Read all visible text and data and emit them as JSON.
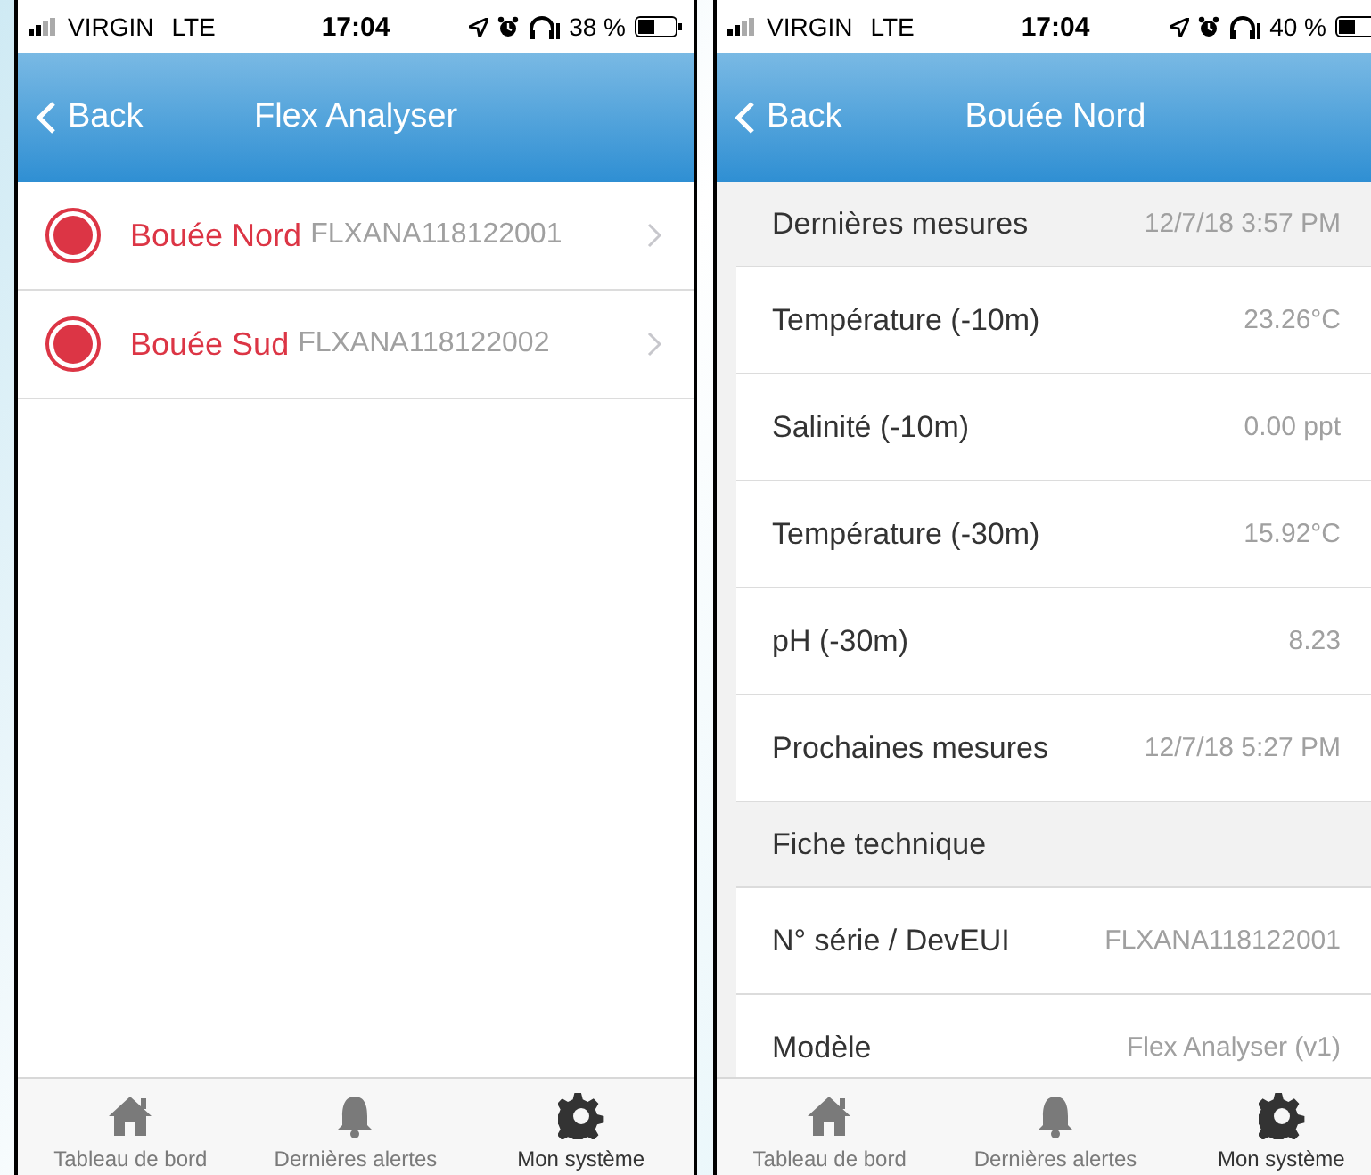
{
  "screens": [
    {
      "kind": "device_list",
      "status_bar": {
        "carrier": "VIRGIN",
        "network": "LTE",
        "time": "17:04",
        "battery_text": "38 %"
      },
      "nav": {
        "back": "Back",
        "title": "Flex Analyser"
      },
      "items": [
        {
          "name": "Bouée Nord",
          "serial": "FLXANA118122001",
          "color": "#dc3545"
        },
        {
          "name": "Bouée Sud",
          "serial": "FLXANA118122002",
          "color": "#dc3545"
        }
      ],
      "tab_bar": [
        {
          "label": "Tableau de bord",
          "selected": false
        },
        {
          "label": "Dernières alertes",
          "selected": false
        },
        {
          "label": "Mon système",
          "selected": true
        }
      ]
    },
    {
      "kind": "device_detail",
      "status_bar": {
        "carrier": "VIRGIN",
        "network": "LTE",
        "time": "17:04",
        "battery_text": "40 %"
      },
      "nav": {
        "back": "Back",
        "title": "Bouée Nord"
      },
      "rows": [
        {
          "kind": "header",
          "label": "Dernières mesures",
          "value": "12/7/18 3:57 PM"
        },
        {
          "kind": "row",
          "label": "Température (-10m)",
          "value": "23.26°C"
        },
        {
          "kind": "row",
          "label": "Salinité (-10m)",
          "value": "0.00 ppt"
        },
        {
          "kind": "row",
          "label": "Température (-30m)",
          "value": "15.92°C"
        },
        {
          "kind": "row",
          "label": "pH (-30m)",
          "value": "8.23"
        },
        {
          "kind": "row",
          "label": "Prochaines mesures",
          "value": "12/7/18 5:27 PM"
        },
        {
          "kind": "header",
          "label": "Fiche technique"
        },
        {
          "kind": "row",
          "label": "N° série / DevEUI",
          "value": "FLXANA118122001"
        },
        {
          "kind": "row",
          "label": "Modèle",
          "value": "Flex Analyser (v1)"
        }
      ],
      "tab_bar": [
        {
          "label": "Tableau de bord",
          "selected": false
        },
        {
          "label": "Dernières alertes",
          "selected": false
        },
        {
          "label": "Mon système",
          "selected": true
        }
      ]
    }
  ]
}
